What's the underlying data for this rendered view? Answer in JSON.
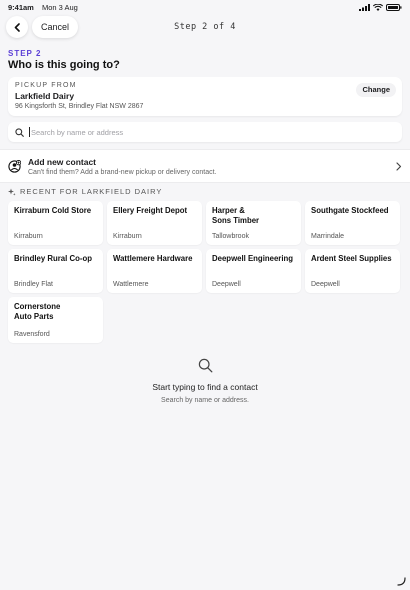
{
  "status_bar": {
    "time": "9:41am",
    "date": "Mon 3 Aug",
    "icons": [
      "signal-icon",
      "wifi-icon",
      "battery-icon"
    ]
  },
  "nav": {
    "back_icon": "chevron-left-icon",
    "cancel_label": "Cancel",
    "step_title": "Step 2 of 4"
  },
  "step": {
    "label": "STEP 2",
    "heading": "Who is this going to?"
  },
  "pickup": {
    "label": "PICKUP FROM",
    "name": "Larkfield Dairy",
    "address": "96 Kingsforth St, Brindley Flat NSW 2867",
    "change_label": "Change"
  },
  "search": {
    "placeholder": "Search by name or address",
    "value": ""
  },
  "add_contact": {
    "title": "Add new contact",
    "subtitle": "Can't find them? Add a brand-new pickup or delivery contact."
  },
  "recent": {
    "label": "RECENT FOR LARKFIELD DAIRY",
    "items": [
      {
        "name": "Kirraburn Cold Store",
        "location": "Kirraburn"
      },
      {
        "name": "Ellery Freight Depot",
        "location": "Kirraburn"
      },
      {
        "name": "Harper &\nSons Timber",
        "location": "Tallowbrook"
      },
      {
        "name": "Southgate Stockfeed",
        "location": "Marrindale"
      },
      {
        "name": "Brindley Rural Co-op",
        "location": "Brindley Flat"
      },
      {
        "name": "Wattlemere Hardware",
        "location": "Wattlemere"
      },
      {
        "name": "Deepwell Engineering",
        "location": "Deepwell"
      },
      {
        "name": "Ardent Steel Supplies",
        "location": "Deepwell"
      },
      {
        "name": "Cornerstone\nAuto Parts",
        "location": "Ravensford"
      }
    ]
  },
  "empty_state": {
    "title": "Start typing to find a contact",
    "subtitle": "Search by name or address."
  },
  "colors": {
    "accent": "#5b3fd6",
    "background": "#f6f6f8",
    "card": "#ffffff"
  }
}
